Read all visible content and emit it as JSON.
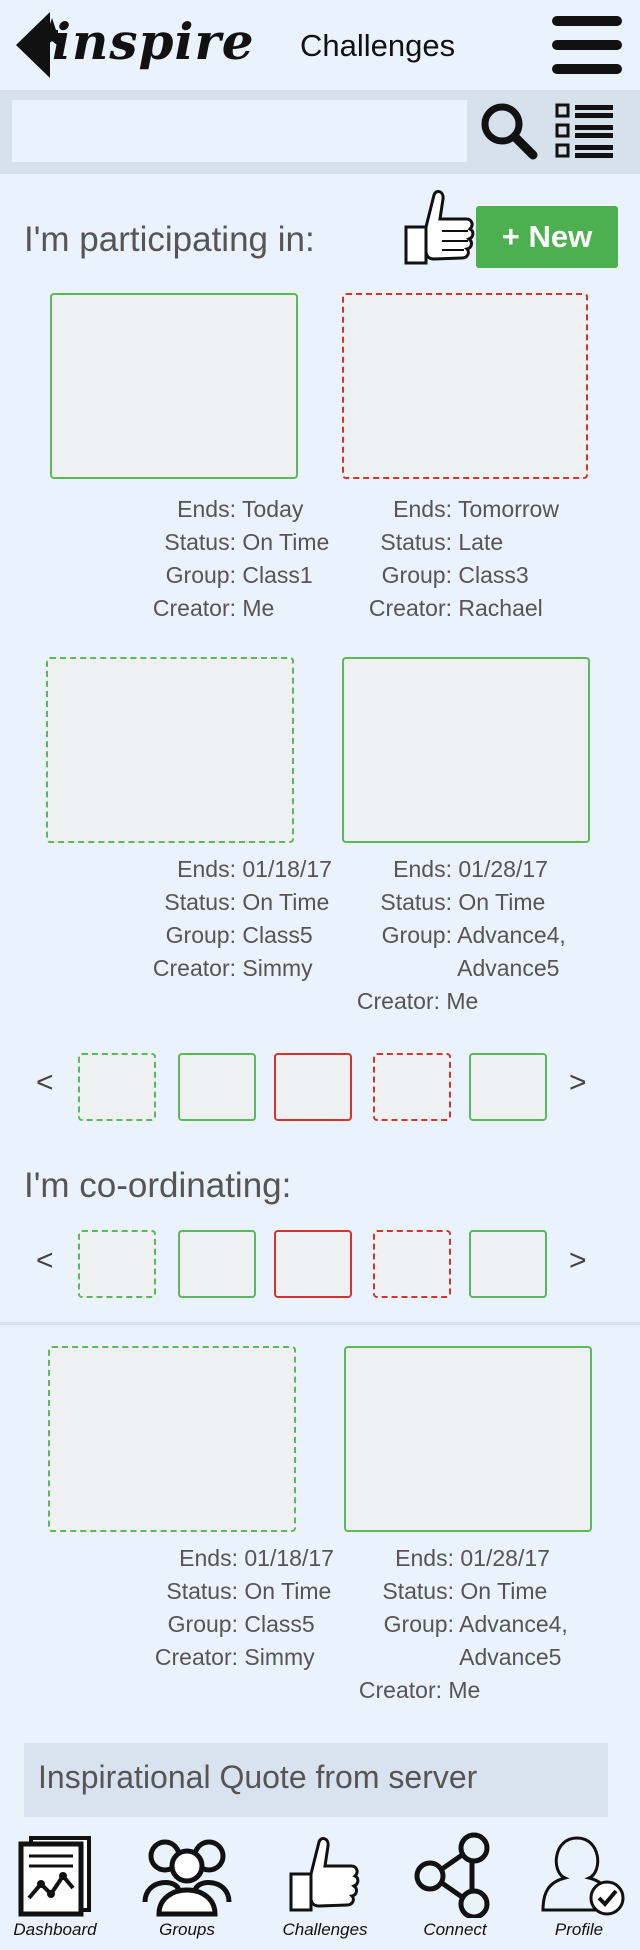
{
  "header": {
    "logo_text": "inspire",
    "title": "Challenges"
  },
  "search": {
    "value": "",
    "placeholder": ""
  },
  "participating": {
    "title": "I'm participating in:",
    "new_button": "+ New",
    "cards": [
      {
        "style": "solid-green",
        "ends": "Today",
        "status": "On Time",
        "group": "Class1",
        "group2": "",
        "creator": "Me"
      },
      {
        "style": "dashed-red",
        "ends": "Tomorrow",
        "status": "Late",
        "group": "Class3",
        "group2": "",
        "creator": "Rachael"
      },
      {
        "style": "dashed-green",
        "ends": "01/18/17",
        "status": "On Time",
        "group": "Class5",
        "group2": "",
        "creator": "Simmy"
      },
      {
        "style": "solid-green",
        "ends": "01/28/17",
        "status": "On Time",
        "group": "Advance4,",
        "group2": "Advance5",
        "creator": "Me"
      }
    ],
    "carousel": [
      "dashed-green",
      "solid-green",
      "solid-red",
      "dashed-red",
      "solid-green"
    ]
  },
  "coordinating": {
    "title": "I'm co-ordinating:",
    "carousel": [
      "dashed-green",
      "solid-green",
      "solid-red",
      "dashed-red",
      "solid-green"
    ],
    "cards": [
      {
        "style": "dashed-green",
        "ends": "01/18/17",
        "status": "On Time",
        "group": "Class5",
        "group2": "",
        "creator": "Simmy"
      },
      {
        "style": "solid-green",
        "ends": "01/28/17",
        "status": "On Time",
        "group": "Advance4,",
        "group2": "Advance5",
        "creator": "Me"
      }
    ]
  },
  "labels": {
    "ends": "Ends:",
    "status": "Status:",
    "group": "Group:",
    "creator": "Creator:"
  },
  "carousel_arrows": {
    "prev": "<",
    "next": ">"
  },
  "quote": "Inspirational Quote from server",
  "bottom_nav": [
    {
      "label": "Dashboard",
      "icon": "dashboard-icon"
    },
    {
      "label": "Groups",
      "icon": "groups-icon"
    },
    {
      "label": "Challenges",
      "icon": "thumbs-up-icon"
    },
    {
      "label": "Connect",
      "icon": "share-icon"
    },
    {
      "label": "Profile",
      "icon": "profile-icon"
    }
  ]
}
